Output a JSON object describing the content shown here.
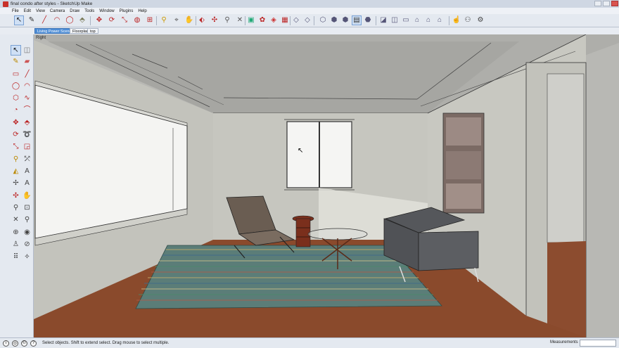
{
  "window": {
    "title": "final condo after styles - SketchUp Make"
  },
  "menu": {
    "items": [
      "File",
      "Edit",
      "View",
      "Camera",
      "Draw",
      "Tools",
      "Window",
      "Plugins",
      "Help"
    ]
  },
  "toolbar": {
    "icons": [
      "select-icon",
      "pencil-icon",
      "line-icon",
      "arc-icon",
      "circle-icon",
      "push-pull-icon",
      "move-icon",
      "rotate-icon",
      "scale-icon",
      "paint-bucket-icon",
      "zoom-icon",
      "zoom-window-icon",
      "zoom-extents-icon",
      "orbit-icon",
      "pan-icon",
      "walk-icon",
      "look-around-icon",
      "section-plane-icon",
      "components-icon",
      "materials-icon",
      "styles-icon",
      "xray-icon",
      "wireframe-icon",
      "hidden-line-icon",
      "shaded-icon",
      "shaded-texture-icon",
      "monochrome-icon",
      "iso-view-icon",
      "top-view-icon",
      "front-view-icon",
      "right-view-icon",
      "back-view-icon",
      "left-view-icon",
      "warehouse-icon",
      "share-model-icon",
      "extension-icon"
    ]
  },
  "scenes": {
    "tabs": [
      "Living Power Scene",
      "Floorplan",
      "top"
    ],
    "active_index": 0
  },
  "viewport": {
    "view_label": "Right"
  },
  "status": {
    "text": "Select objects. Shift to extend select. Drag mouse to select multiple.",
    "measurements_label": "Measurements",
    "measurements_value": ""
  },
  "colors": {
    "wall": "#c7c7c0",
    "ceiling": "#a9a9a5",
    "floor_wood": "#8a4a2c",
    "rug": "#5b7d78",
    "selection_accent": "#4f8ed6"
  }
}
